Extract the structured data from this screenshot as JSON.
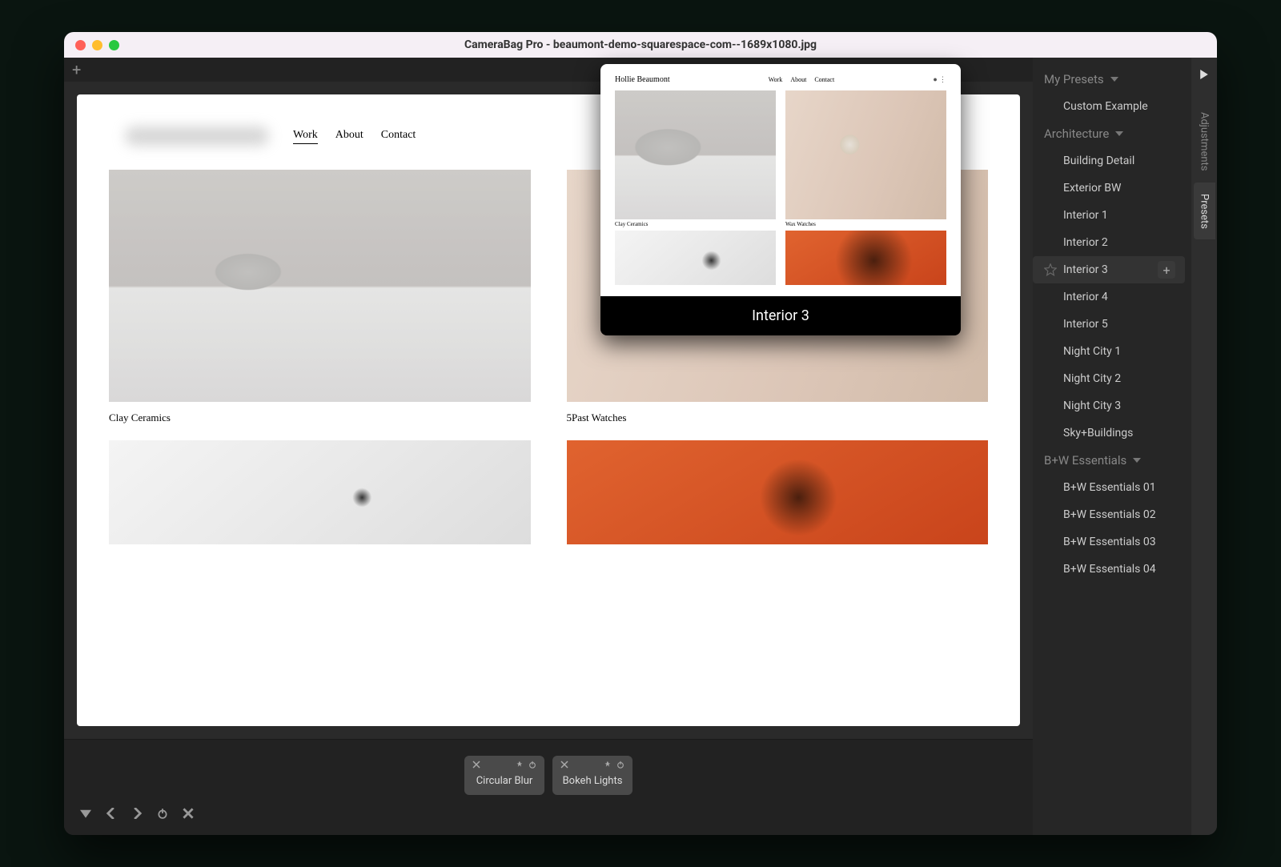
{
  "window": {
    "title": "CameraBag Pro - beaumont-demo-squarespace-com--1689x1080.jpg"
  },
  "canvas": {
    "nav": {
      "work": "Work",
      "about": "About",
      "contact": "Contact"
    },
    "caption_left": "Clay Ceramics",
    "caption_right": "5Past Watches"
  },
  "preview": {
    "label": "Interior 3",
    "logo": "Hollie Beaumont",
    "nav": {
      "work": "Work",
      "about": "About",
      "contact": "Contact"
    },
    "cap1": "Clay Ceramics",
    "cap2": "Wax Watches"
  },
  "adjustments": [
    {
      "label": "Circular Blur"
    },
    {
      "label": "Bokeh Lights"
    }
  ],
  "sidebar": {
    "tabs": {
      "adjustments": "Adjustments",
      "presets": "Presets"
    },
    "groups": [
      {
        "name": "My Presets",
        "items": [
          "Custom Example"
        ]
      },
      {
        "name": "Architecture",
        "items": [
          "Building Detail",
          "Exterior BW",
          "Interior 1",
          "Interior 2",
          "Interior 3",
          "Interior 4",
          "Interior 5",
          "Night City 1",
          "Night City 2",
          "Night City 3",
          "Sky+Buildings"
        ]
      },
      {
        "name": "B+W Essentials",
        "items": [
          "B+W Essentials 01",
          "B+W Essentials 02",
          "B+W Essentials 03",
          "B+W Essentials 04"
        ]
      }
    ],
    "hovered_preset": "Interior 3"
  }
}
